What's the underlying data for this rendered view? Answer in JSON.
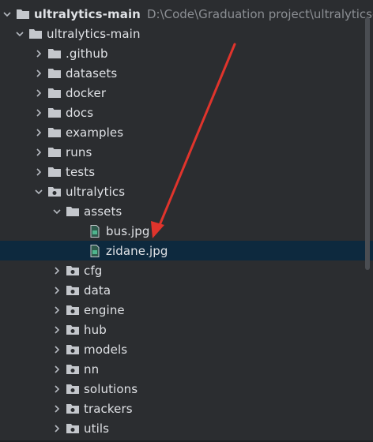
{
  "root": {
    "label": "ultralytics-main",
    "path": "D:\\Code\\Graduation project\\ultralytics-m"
  },
  "items": [
    {
      "label": "ultralytics-main"
    },
    {
      "label": ".github"
    },
    {
      "label": "datasets"
    },
    {
      "label": "docker"
    },
    {
      "label": "docs"
    },
    {
      "label": "examples"
    },
    {
      "label": "runs"
    },
    {
      "label": "tests"
    },
    {
      "label": "ultralytics"
    },
    {
      "label": "assets"
    },
    {
      "label": "bus.jpg"
    },
    {
      "label": "zidane.jpg"
    },
    {
      "label": "cfg"
    },
    {
      "label": "data"
    },
    {
      "label": "engine"
    },
    {
      "label": "hub"
    },
    {
      "label": "models"
    },
    {
      "label": "nn"
    },
    {
      "label": "solutions"
    },
    {
      "label": "trackers"
    },
    {
      "label": "utils"
    }
  ],
  "colors": {
    "background": "#2b2d30",
    "selection": "#0d293e",
    "folder": "#c4c7cc",
    "arrow": "#e0342c"
  }
}
